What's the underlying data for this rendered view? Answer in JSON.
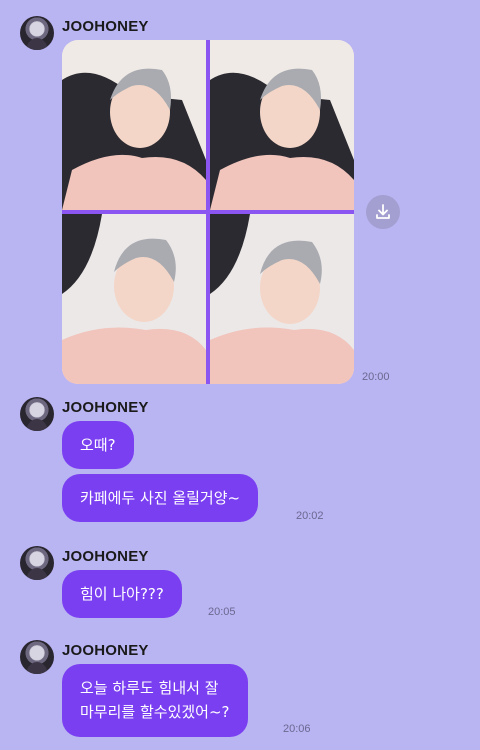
{
  "chat": {
    "groups": [
      {
        "sender": "JOOHONEY",
        "attachment": "photo-grid",
        "time": "20:00"
      },
      {
        "sender": "JOOHONEY",
        "messages": [
          "오때?",
          "카페에두 사진 올릴거양~"
        ],
        "time": "20:02"
      },
      {
        "sender": "JOOHONEY",
        "messages": [
          "힘이 나아???"
        ],
        "time": "20:05"
      },
      {
        "sender": "JOOHONEY",
        "messages": [
          "오늘 하루도 힘내서 잘\n마무리를 할수있겠어~?"
        ],
        "time": "20:06"
      }
    ]
  },
  "icons": {
    "download": "download-icon"
  },
  "colors": {
    "background": "#b9b4f2",
    "bubble": "#7b3ff2",
    "bubble_text": "#ffffff"
  }
}
